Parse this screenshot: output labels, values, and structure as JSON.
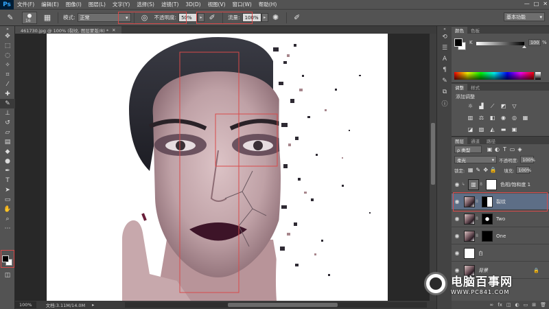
{
  "app": {
    "logo": "Ps"
  },
  "menu": [
    "文件(F)",
    "编辑(E)",
    "图像(I)",
    "图层(L)",
    "文字(Y)",
    "选择(S)",
    "滤镜(T)",
    "3D(D)",
    "视图(V)",
    "窗口(W)",
    "帮助(H)"
  ],
  "window_controls": [
    "—",
    "□",
    "✕"
  ],
  "options": {
    "brush_size": "16",
    "mode_label": "模式:",
    "mode_value": "正常",
    "opacity_label": "不透明度:",
    "opacity_value": "50%",
    "flow_label": "流量:",
    "flow_value": "100%",
    "workspace": "基本功能"
  },
  "document": {
    "tab_title": "461730.jpg @ 100% (裂纹, 图层蒙版/8) *",
    "zoom": "100%",
    "doc_size": "文档:3.11M/14.0M"
  },
  "color_panel": {
    "tabs": [
      "颜色",
      "色板"
    ],
    "channel_label": "K",
    "channel_value": "100",
    "channel_unit": "%",
    "slider_fraction": 1.0
  },
  "adjustments_panel": {
    "tabs": [
      "调整",
      "样式"
    ],
    "title": "添加调整"
  },
  "layers_panel": {
    "tabs": [
      "图层",
      "通道",
      "路径"
    ],
    "filter_label": "ρ 类型",
    "blend_mode": "柔光",
    "opacity_label": "不透明度:",
    "opacity_value": "100%",
    "lock_label": "锁定:",
    "fill_label": "填充:",
    "fill_value": "100%",
    "layers": [
      {
        "name": "色相/饱和度 1",
        "kind": "adjustment",
        "selected": false
      },
      {
        "name": "裂纹",
        "kind": "masked",
        "selected": true
      },
      {
        "name": "Two",
        "kind": "masked",
        "selected": false
      },
      {
        "name": "One",
        "kind": "masked",
        "selected": false
      },
      {
        "name": "白",
        "kind": "fill",
        "selected": false
      },
      {
        "name": "背景",
        "kind": "background",
        "selected": false
      }
    ]
  },
  "watermark": {
    "title": "电脑百事网",
    "url": "WWW.PC841.COM"
  }
}
